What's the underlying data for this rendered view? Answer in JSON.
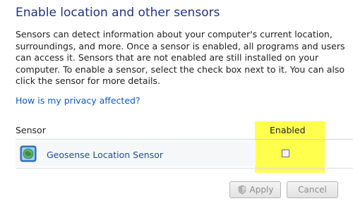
{
  "page": {
    "title": "Enable location and other sensors",
    "description": "Sensors can detect information about your computer's current location, surroundings, and more. Once a sensor is enabled, all programs and users can access it. Sensors that are not enabled are still installed on your computer. To enable a sensor, select the check box next to it. You can also click the sensor for more details.",
    "privacy_link": "How is my privacy affected?"
  },
  "table": {
    "columns": [
      "Sensor",
      "Enabled"
    ],
    "rows": [
      {
        "name": "Geosense Location Sensor",
        "icon": "location-sensor-icon",
        "enabled": false
      }
    ]
  },
  "buttons": {
    "apply": "Apply",
    "cancel": "Cancel"
  },
  "colors": {
    "title": "#1e3287",
    "link": "#0b5bc7",
    "highlight": "#ffff4d"
  }
}
